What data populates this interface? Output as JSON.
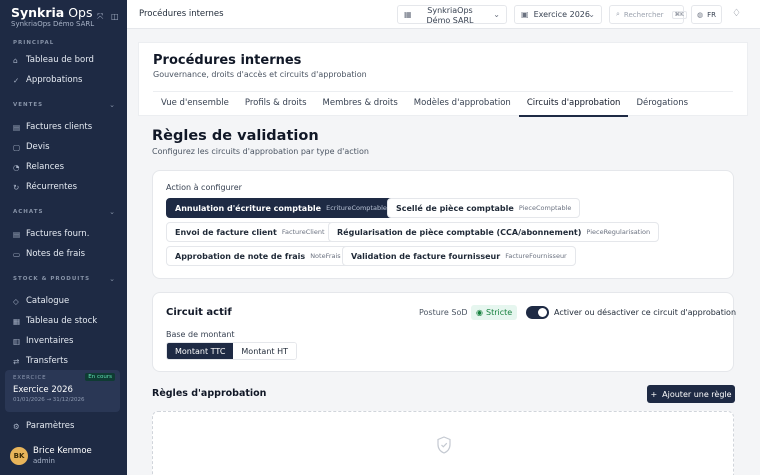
{
  "sidebar": {
    "brand_a": "Synkria",
    "brand_b": " Ops",
    "org": "SynkriaOps Démo SARL",
    "sections": {
      "principal": "PRINCIPAL",
      "ventes": "VENTES",
      "achats": "ACHATS",
      "stock": "STOCK & PRODUITS"
    },
    "items": {
      "dashboard": "Tableau de bord",
      "approvals": "Approbations",
      "invoices": "Factures clients",
      "quotes": "Devis",
      "reminders": "Relances",
      "recurring": "Récurrentes",
      "supplier_invoices": "Factures fourn.",
      "expenses": "Notes de frais",
      "catalog": "Catalogue",
      "stock_board": "Tableau de stock",
      "inventories": "Inventaires",
      "transfers": "Transferts",
      "settings": "Paramètres"
    },
    "fiscal": {
      "label": "EXERCICE",
      "badge": "En cours",
      "name": "Exercice 2026",
      "dates": "01/01/2026 → 31/12/2026"
    },
    "user": {
      "initials": "BK",
      "name": "Brice Kenmoe",
      "role": "admin"
    }
  },
  "topbar": {
    "title": "Procédures internes",
    "org": "SynkriaOps Démo SARL",
    "exercise": "Exercice 2026",
    "search_placeholder": "Rechercher",
    "shortcut": "⌘K",
    "lang": "FR"
  },
  "header": {
    "title": "Procédures internes",
    "subtitle": "Gouvernance, droits d'accès et circuits d'approbation",
    "tabs": [
      "Vue d'ensemble",
      "Profils & droits",
      "Membres & droits",
      "Modèles d'approbation",
      "Circuits d'approbation",
      "Dérogations"
    ]
  },
  "section": {
    "title": "Règles de validation",
    "subtitle": "Configurez les circuits d'approbation par type d'action"
  },
  "actions": {
    "label": "Action à configurer",
    "items": [
      {
        "label": "Annulation d'écriture comptable",
        "code": "EcritureComptable"
      },
      {
        "label": "Scellé de pièce comptable",
        "code": "PieceComptable"
      },
      {
        "label": "Envoi de facture client",
        "code": "FactureClient"
      },
      {
        "label": "Régularisation de pièce comptable (CCA/abonnement)",
        "code": "PieceRegularisation"
      },
      {
        "label": "Approbation de note de frais",
        "code": "NoteFrais"
      },
      {
        "label": "Validation de facture fournisseur",
        "code": "FactureFournisseur"
      }
    ]
  },
  "circuit": {
    "title": "Circuit actif",
    "sod_label": "Posture SoD",
    "sod_value": "Stricte",
    "toggle_label": "Activer ou désactiver ce circuit d'approbation",
    "base_label": "Base de montant",
    "base_options": [
      "Montant TTC",
      "Montant HT"
    ]
  },
  "rules": {
    "title": "Règles d'approbation",
    "add_label": "Ajouter une règle"
  }
}
